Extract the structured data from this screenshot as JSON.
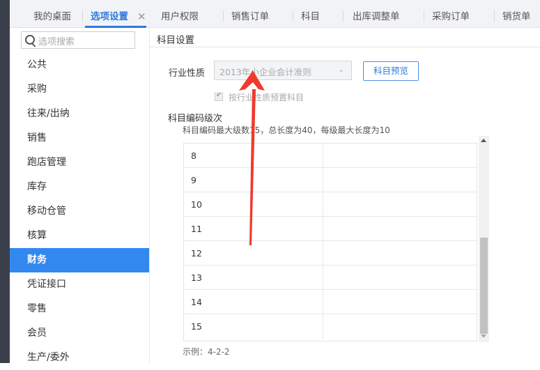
{
  "tabs": [
    {
      "label": "我的桌面"
    },
    {
      "label": "选项设置"
    },
    {
      "label": "用户权限"
    },
    {
      "label": "销售订单"
    },
    {
      "label": "科目"
    },
    {
      "label": "出库调整单"
    },
    {
      "label": "采购订单"
    },
    {
      "label": "销货单"
    }
  ],
  "tab_close": "✕",
  "sidebar": {
    "search_placeholder": "选项搜索",
    "items": [
      {
        "label": "公共"
      },
      {
        "label": "采购"
      },
      {
        "label": "往来/出纳"
      },
      {
        "label": "销售"
      },
      {
        "label": "跑店管理"
      },
      {
        "label": "库存"
      },
      {
        "label": "移动仓管"
      },
      {
        "label": "核算"
      },
      {
        "label": "财务"
      },
      {
        "label": "凭证接口"
      },
      {
        "label": "零售"
      },
      {
        "label": "会员"
      },
      {
        "label": "生产/委外"
      }
    ],
    "active_index": 8
  },
  "main": {
    "section_title": "科目设置",
    "industry_label": "行业性质",
    "industry_value": "2013年小企业会计准则",
    "preview_button": "科目预览",
    "preset_checkbox_label": "按行业性质预置科目",
    "preset_checked": true,
    "code_title": "科目编码级次",
    "code_desc": "科目编码最大级数15，总长度为40，每级最大长度为10",
    "rows": [
      "8",
      "9",
      "10",
      "11",
      "12",
      "13",
      "14",
      "15"
    ],
    "example": "示例：4-2-2"
  },
  "colors": {
    "accent": "#3388f0",
    "arrow": "#f03a2e"
  }
}
